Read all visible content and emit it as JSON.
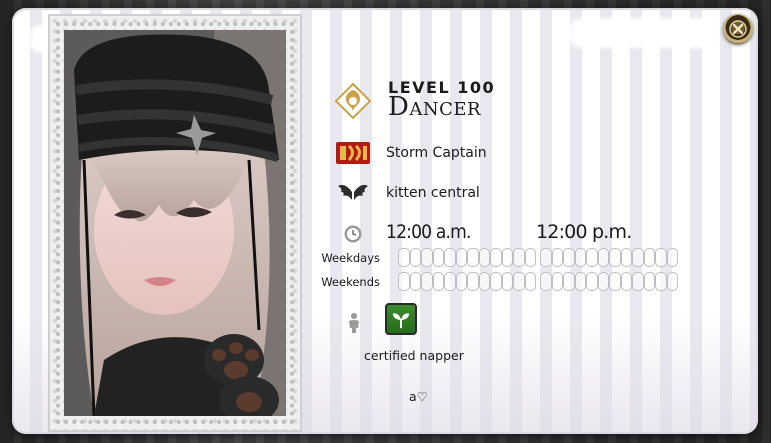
{
  "job": {
    "level_label": "LEVEL 100",
    "name": "Dancer",
    "icon": "dancer-job-icon"
  },
  "grand_company": {
    "icon": "maelstrom-emblem-icon",
    "rank": "Storm Captain"
  },
  "free_company": {
    "icon": "wings-crest-icon",
    "name": "kitten central"
  },
  "schedule": {
    "icon": "clock-icon",
    "start_time": "12:00 a.m.",
    "end_time": "12:00 p.m.",
    "weekdays_label": "Weekdays",
    "weekends_label": "Weekends",
    "slot_groups": [
      12,
      12
    ]
  },
  "roleplay": {
    "body_icon": "person-icon",
    "mentor_icon": "sprout-icon"
  },
  "bio": {
    "line1": "certified napper",
    "line2": "a♡"
  },
  "colors": {
    "card_stripe_light": "#ffffff",
    "card_stripe_dark": "#e8e8ee",
    "text": "#1a1a1a",
    "gold": "#c9a24a",
    "mentor_green": "#3d8c2e"
  }
}
